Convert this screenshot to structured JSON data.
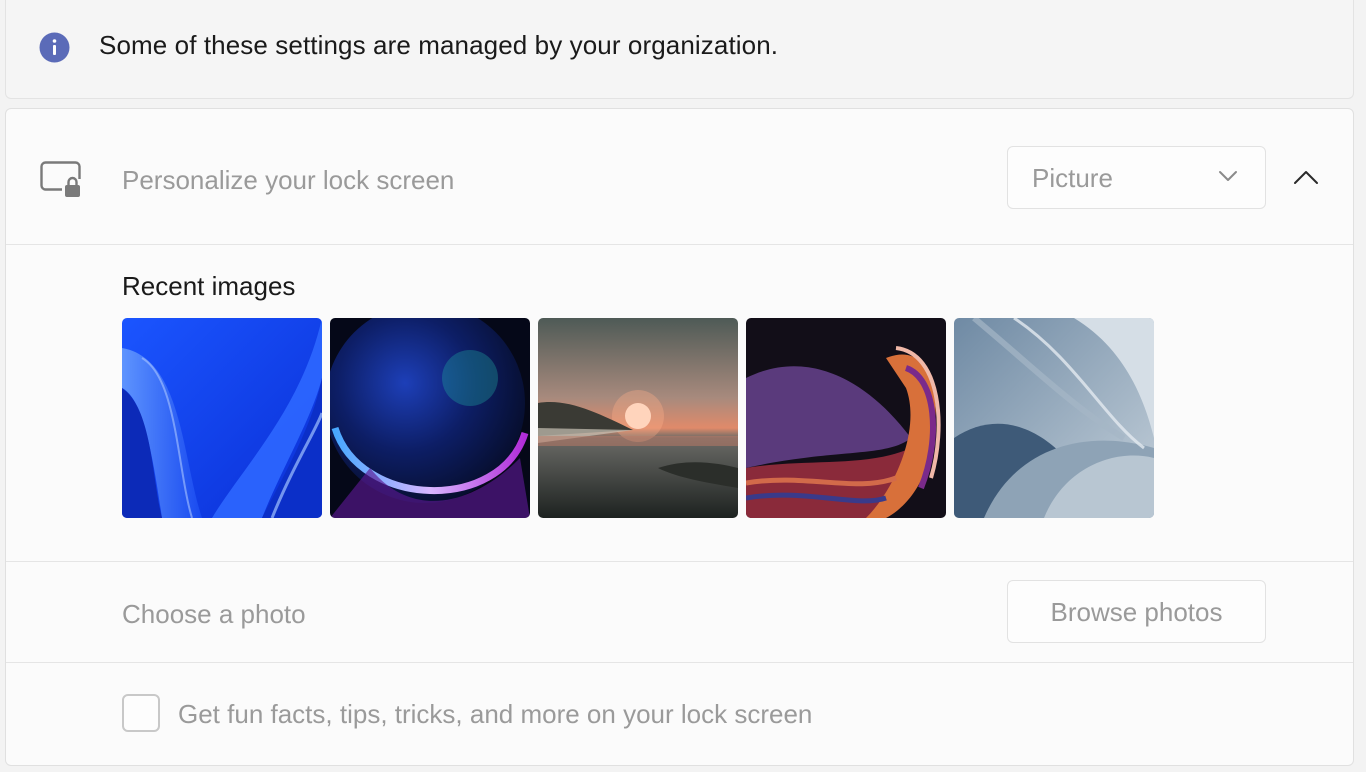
{
  "notice": {
    "text": "Some of these settings are managed by your organization.",
    "icon": "info-icon",
    "icon_color": "#5b6bb8"
  },
  "lock_screen": {
    "label": "Personalize your lock screen",
    "icon": "lock-screen-icon",
    "dropdown_value": "Picture",
    "expanded": true
  },
  "recent_images": {
    "title": "Recent images",
    "images": [
      "Blue bloom wallpaper",
      "Glowing purple orb wallpaper",
      "Sunset over lake wallpaper",
      "Purple ribbon wallpaper",
      "Gray-blue flow wallpaper"
    ]
  },
  "choose_photo": {
    "label": "Choose a photo",
    "button_label": "Browse photos"
  },
  "tips": {
    "label": "Get fun facts, tips, tricks, and more on your lock screen",
    "checked": false
  }
}
